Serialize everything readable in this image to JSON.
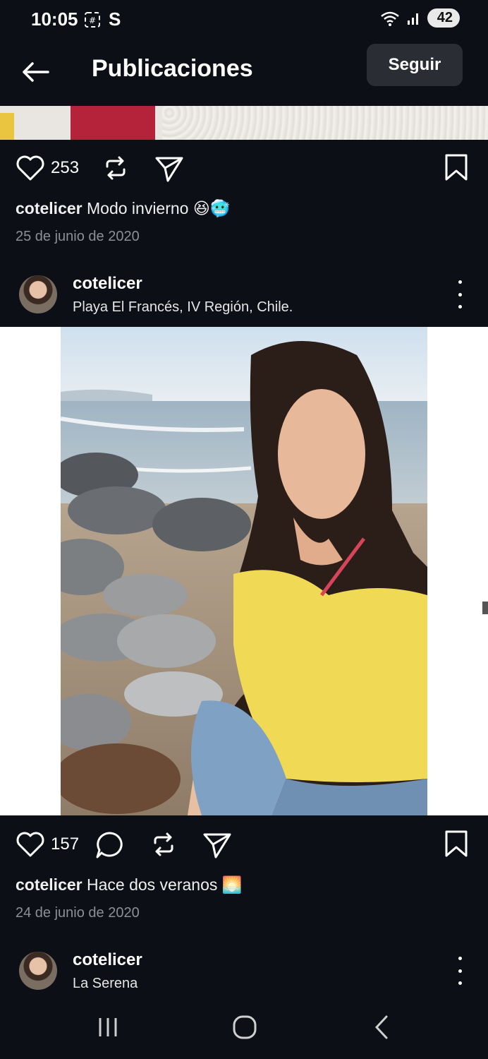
{
  "status_bar": {
    "time": "10:05",
    "battery": "42",
    "icons": [
      "screen-record-icon",
      "s-app-icon",
      "wifi-icon",
      "signal-icon",
      "battery-icon"
    ]
  },
  "header": {
    "title": "Publicaciones",
    "follow_label": "Seguir"
  },
  "post1": {
    "likes": "253",
    "username": "cotelicer",
    "caption": "Modo invierno 😆🥶",
    "date": "25 de junio de 2020"
  },
  "post2": {
    "username": "cotelicer",
    "location": "Playa El Francés, IV Región, Chile.",
    "likes": "157",
    "caption": "Hace dos veranos 🌅",
    "date": "24 de junio de 2020"
  },
  "post3": {
    "username": "cotelicer",
    "location": "La Serena"
  },
  "nav": {
    "icons": [
      "recents-icon",
      "home-icon",
      "back-icon"
    ]
  },
  "colors": {
    "background": "#0d0f16",
    "button": "#2a2d33",
    "secondary_text": "#8c8f96"
  }
}
